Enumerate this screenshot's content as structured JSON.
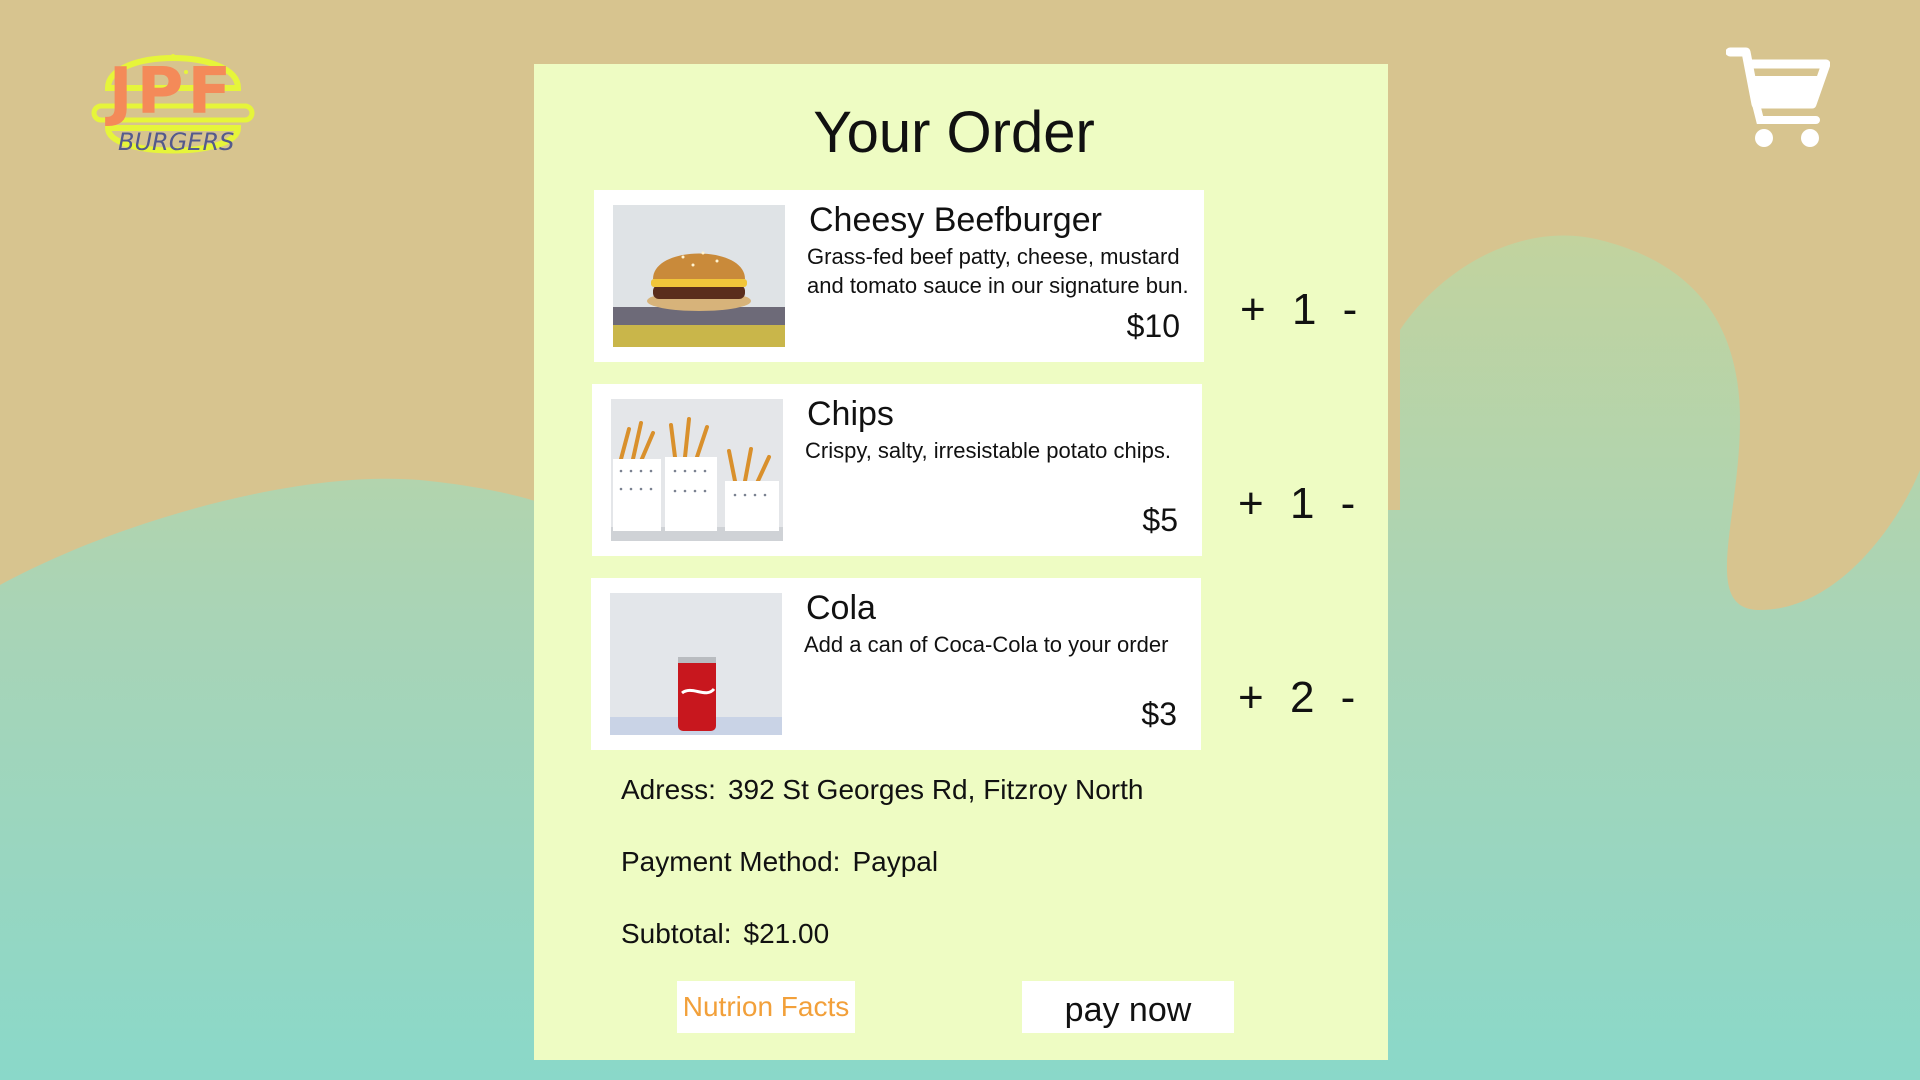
{
  "brand": {
    "logo_main": "JPF",
    "logo_sub": "BURGERS"
  },
  "header": {
    "cart_icon": "shopping-cart-icon"
  },
  "order": {
    "title": "Your Order",
    "items": [
      {
        "name": "Cheesy Beefburger",
        "description": "Grass-fed beef patty, cheese, mustard and tomato sauce in our signature bun.",
        "price": "$10",
        "quantity": "1",
        "plus": "+",
        "minus": "-",
        "image": "burger-photo"
      },
      {
        "name": "Chips",
        "description": "Crispy, salty, irresistable potato chips.",
        "price": "$5",
        "quantity": "1",
        "plus": "+",
        "minus": "-",
        "image": "chips-photo"
      },
      {
        "name": "Cola",
        "description": "Add a can of Coca-Cola to your order",
        "price": "$3",
        "quantity": "2",
        "plus": "+",
        "minus": "-",
        "image": "cola-photo"
      }
    ],
    "address_label": "Adress:",
    "address_value": "392 St Georges Rd, Fitzroy North",
    "payment_label": "Payment Method:",
    "payment_value": "Paypal",
    "subtotal_label": "Subtotal:",
    "subtotal_value": "$21.00"
  },
  "actions": {
    "nutrition_label": "Nutrion Facts",
    "pay_label": "pay now"
  },
  "colors": {
    "background_sand": "#d7c48f",
    "background_teal": "#8cd6c6",
    "panel": "#eefcc3",
    "accent_orange": "#f2a03a",
    "logo_outline": "#e6f53a"
  }
}
